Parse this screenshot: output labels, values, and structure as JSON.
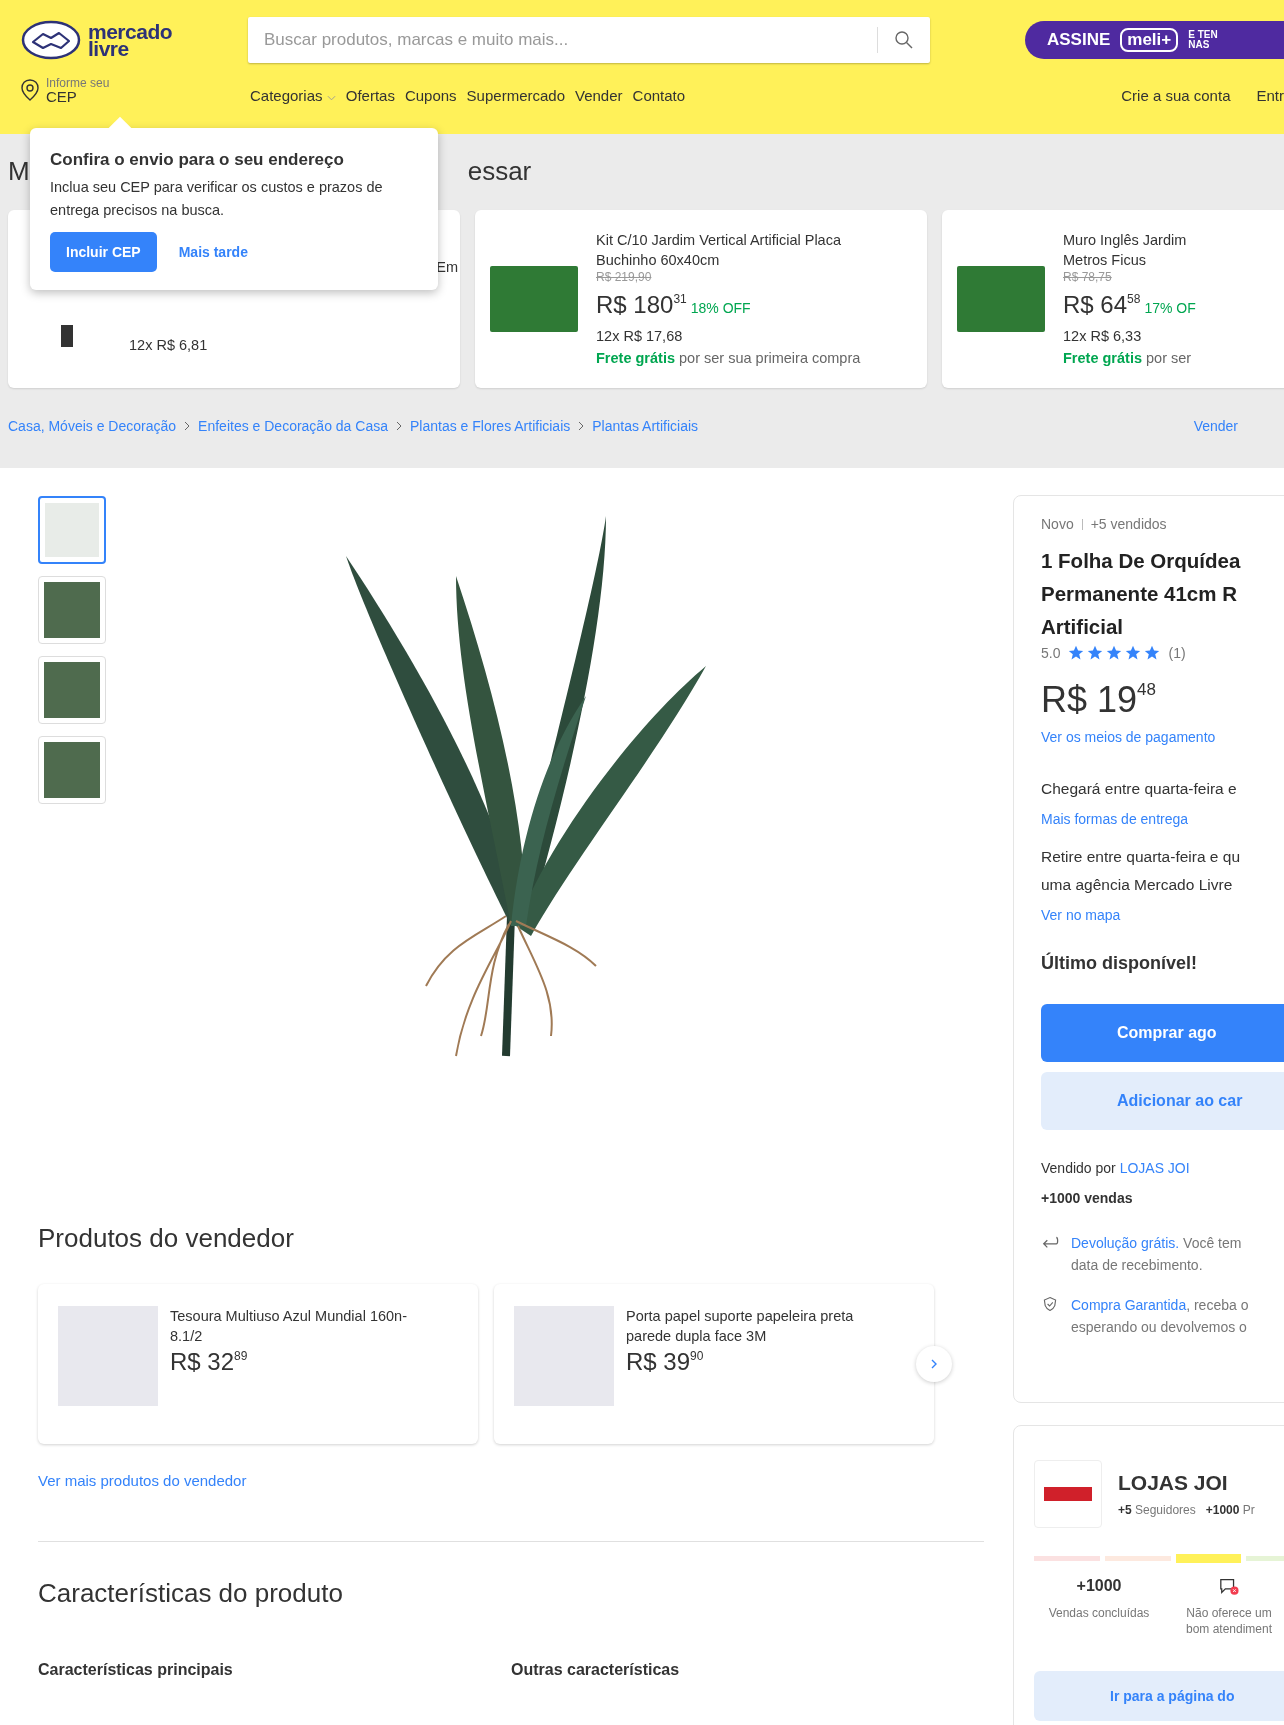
{
  "header": {
    "logo": {
      "lines": [
        "mercado",
        "livre"
      ]
    },
    "search": {
      "placeholder": "Buscar produtos, marcas e muito mais..."
    },
    "promo": {
      "cta": "ASSINE",
      "brand": "meli+",
      "tagline": [
        "E TEN",
        "NAS"
      ]
    },
    "location": {
      "label": "Informe seu",
      "value": "CEP"
    },
    "nav": [
      {
        "label": "Categorias",
        "kind": "dropdown"
      },
      {
        "label": "Ofertas",
        "kind": "link"
      },
      {
        "label": "Cupons",
        "kind": "link"
      },
      {
        "label": "Supermercado",
        "kind": "link"
      },
      {
        "label": "Vender",
        "kind": "link"
      },
      {
        "label": "Contato",
        "kind": "link"
      }
    ],
    "account_links": [
      "Crie a sua conta",
      "Entr"
    ]
  },
  "cep_popover": {
    "title": "Confira o envio para o seu endereço",
    "text": "Inclua seu CEP para verificar os custos e prazos de entrega precisos na busca.",
    "primary": "Incluir CEP",
    "secondary": "Mais tarde"
  },
  "recent": {
    "heading_parts": [
      "M",
      "essar"
    ],
    "items": [
      {
        "covered": true,
        "title_lines": [
          "Em"
        ],
        "installments": "12x R$ 6,81"
      },
      {
        "covered": false,
        "title_lines": [
          "Kit C/10 Jardim Vertical Artificial Placa",
          "Buchinho 60x40cm"
        ],
        "old_price": "R$ 219,90",
        "price": "R$ 180",
        "cents": "31",
        "discount": "18% OFF",
        "installments": "12x R$ 17,68",
        "shipping_bold": "Frete grátis",
        "shipping": "por ser sua primeira compra"
      },
      {
        "covered": false,
        "title_lines": [
          "Muro Inglês Jardim",
          "Metros Ficus"
        ],
        "old_price": "R$ 78,75",
        "price": "R$ 64",
        "cents": "58",
        "discount": "17% OF",
        "installments": "12x R$ 6,33",
        "shipping_bold": "Frete grátis",
        "shipping": "por ser"
      }
    ]
  },
  "breadcrumb": {
    "items": [
      "Casa, Móveis e Decoração",
      "Enfeites e Decoração da Casa",
      "Plantas e Flores Artificiais",
      "Plantas Artificiais"
    ],
    "action": "Vender"
  },
  "gallery": {
    "thumbnails": [
      {
        "selected": true
      },
      {
        "selected": false
      },
      {
        "selected": false
      },
      {
        "selected": false
      }
    ]
  },
  "seller_products": {
    "title": "Produtos do vendedor",
    "items": [
      {
        "title_lines": [
          "Tesoura Multiuso Azul Mundial 160n-",
          "8.1/2"
        ],
        "price": "R$ 32",
        "cents": "89"
      },
      {
        "title_lines": [
          "Porta papel suporte papeleira preta",
          "parede dupla face 3M"
        ],
        "price": "R$ 39",
        "cents": "90"
      }
    ],
    "more_link": "Ver mais produtos do vendedor"
  },
  "specs": {
    "title": "Características do produto",
    "columns": [
      "Características principais",
      "Outras características"
    ]
  },
  "buy_box": {
    "condition": "Novo",
    "sold": "+5 vendidos",
    "title_lines": [
      "1 Folha De Orquídea",
      "Permanente 41cm R",
      "Artificial"
    ],
    "rating": {
      "score": "5.0",
      "stars": 5,
      "count": "(1)"
    },
    "price": "R$ 19",
    "cents": "48",
    "payment_link": "Ver os meios de pagamento",
    "delivery": "Chegará entre quarta-feira e",
    "delivery_link": "Mais formas de entrega",
    "pickup_lines": [
      "Retire entre quarta-feira e qu",
      "uma agência Mercado Livre"
    ],
    "map_link": "Ver no mapa",
    "stock": "Último disponível!",
    "buy_button": "Comprar ago",
    "cart_button": "Adicionar ao car",
    "sold_by": "Vendido por",
    "seller": "LOJAS JOI",
    "seller_sales": "+1000 vendas",
    "benefits": [
      {
        "kind": "return",
        "link": "Devolução grátis.",
        "lines": [
          " Você tem",
          "data de recebimento."
        ]
      },
      {
        "kind": "guarantee",
        "link": "Compra Garantida",
        "lines": [
          ", receba o",
          "esperando ou devolvemos o"
        ]
      }
    ]
  },
  "seller_card": {
    "name": "LOJAS JOI",
    "followers_count": "+5",
    "followers": "Seguidores",
    "products_count": "+1000",
    "products": "Pr",
    "reputation": [
      {
        "color": "#fbe1e1",
        "selected": false
      },
      {
        "color": "#fde9df",
        "selected": false
      },
      {
        "color": "#fff159",
        "selected": true
      },
      {
        "color": "#e6f4d6",
        "selected": false
      }
    ],
    "metrics": [
      {
        "kind": "value",
        "value": "+1000",
        "label": "Vendas concluídas"
      },
      {
        "kind": "alert-icon",
        "label": "Não oferece um bom atendiment"
      }
    ],
    "button": "Ir para a página do"
  }
}
